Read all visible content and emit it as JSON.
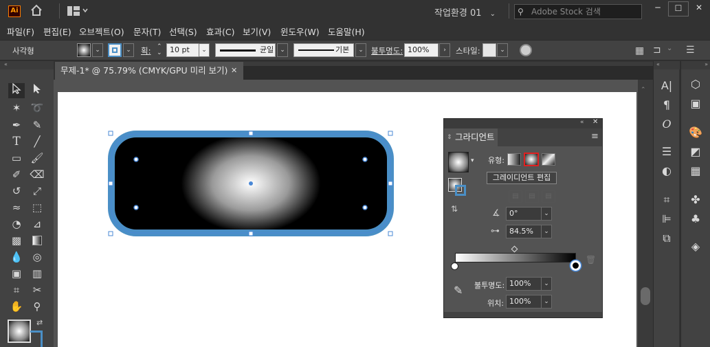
{
  "titlebar": {
    "logo": "Ai",
    "workspace": "작업환경 01",
    "search_placeholder": "Adobe Stock 검색",
    "minimize": "─",
    "maximize": "☐",
    "close": "✕"
  },
  "menu": [
    {
      "label": "파일(F)"
    },
    {
      "label": "편집(E)"
    },
    {
      "label": "오브젝트(O)"
    },
    {
      "label": "문자(T)"
    },
    {
      "label": "선택(S)"
    },
    {
      "label": "효과(C)"
    },
    {
      "label": "보기(V)"
    },
    {
      "label": "윈도우(W)"
    },
    {
      "label": "도움말(H)"
    }
  ],
  "control_bar": {
    "object_label": "사각형",
    "stroke_label": "획:",
    "stroke_weight": "10 pt",
    "profile_uniform": "균일",
    "brush_basic": "기본",
    "opacity_label": "불투명도:",
    "opacity_value": "100%",
    "style_label": "스타일:"
  },
  "document_tab": {
    "title": "무제-1* @ 75.79% (CMYK/GPU 미리 보기)",
    "close": "✕"
  },
  "gradient_panel": {
    "tab_label": "그라디언트",
    "type_label": "유형:",
    "tooltip": "그레이디언트 편집",
    "angle_value": "0°",
    "aspect_value": "84.5%",
    "opacity_label": "불투명도:",
    "opacity_value": "100%",
    "location_label": "위치:",
    "location_value": "100%"
  },
  "colors": {
    "accent_selection": "#4a88d6",
    "stroke_blue": "#4a8fc6",
    "highlight_red": "#e02020",
    "ai_orange": "#ff9a00"
  }
}
